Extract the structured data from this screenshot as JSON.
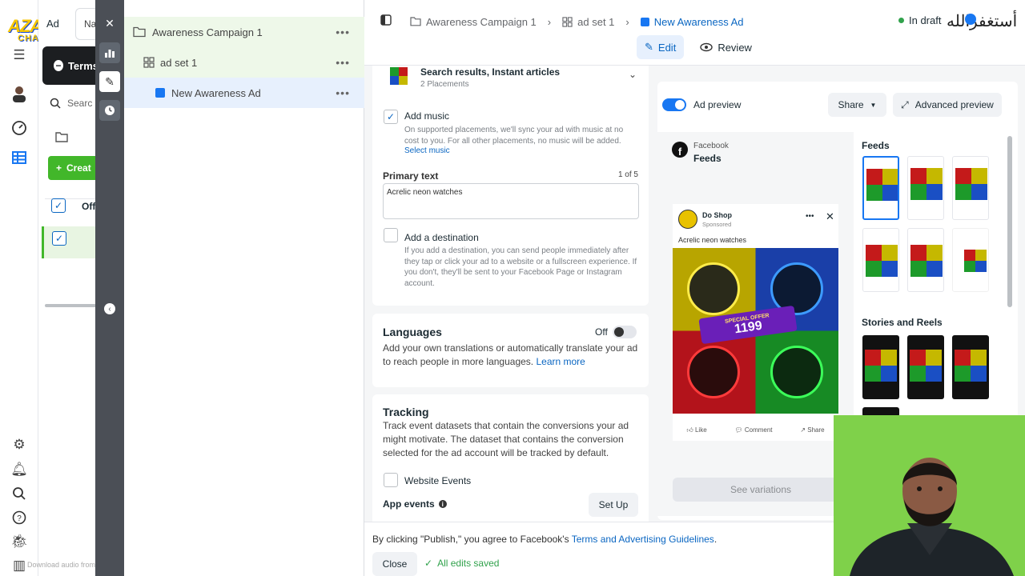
{
  "brand": {
    "logo_top": "AZAD",
    "logo_bottom": "CHAIWALA",
    "corner_script": "أستغفرالله"
  },
  "background": {
    "tab_partial": "Ad",
    "tab_partial_2": "Na",
    "terms_label": "Terms",
    "search_placeholder": "Searc",
    "create_label": "Creat",
    "column_partial": "Off",
    "download_hint": "Download audio from this page"
  },
  "tree": {
    "campaign": "Awareness Campaign 1",
    "adset": "ad set 1",
    "ad": "New Awareness Ad",
    "more_glyph": "•••"
  },
  "topbar": {
    "crumb_campaign": "Awareness Campaign 1",
    "crumb_adset": "ad set 1",
    "crumb_ad": "New Awareness Ad",
    "status": "In draft",
    "tab_edit": "Edit",
    "tab_review": "Review"
  },
  "editor": {
    "placements_title": "Search results, Instant articles",
    "placements_sub": "2 Placements",
    "music_label": "Add music",
    "music_help": "On supported placements, we'll sync your ad with music at no cost to you. For all other placements, no music will be added.",
    "music_link": "Select music",
    "primary_text_label": "Primary text",
    "primary_text_count": "1 of 5",
    "primary_text_value": "Acrelic neon watches",
    "destination_label": "Add a destination",
    "destination_help": "If you add a destination, you can send people immediately after they tap or click your ad to a website or a fullscreen experience. If you don't, they'll be sent to your Facebook Page or Instagram account.",
    "languages_title": "Languages",
    "languages_state": "Off",
    "languages_help": "Add your own translations or automatically translate your ad to reach people in more languages.",
    "languages_link": "Learn more",
    "tracking_title": "Tracking",
    "tracking_help": "Track event datasets that contain the conversions your ad might motivate. The dataset that contains the conversion selected for the ad account will be tracked by default.",
    "website_events": "Website Events",
    "app_events": "App events",
    "setup_btn": "Set Up"
  },
  "preview": {
    "toggle_label": "Ad preview",
    "share_btn": "Share",
    "advanced_btn": "Advanced preview",
    "platform": "Facebook",
    "placement": "Feeds",
    "post_page": "Do Shop",
    "post_sponsored": "Sponsored",
    "post_text": "Acrelic neon watches",
    "offer_text": "SPECIAL OFFER",
    "price_text": "1199",
    "like": "Like",
    "comment": "Comment",
    "share": "Share",
    "variations_btn": "See variations",
    "feeds_heading": "Feeds",
    "stories_heading": "Stories and Reels"
  },
  "footer": {
    "agree_prefix": "By clicking \"Publish,\" you agree to Facebook's ",
    "agree_link": "Terms and Advertising Guidelines",
    "agree_suffix": ".",
    "close_btn": "Close",
    "saved": "All edits saved"
  },
  "colors": {
    "accent": "#0a66c2",
    "toggle": "#1877f2",
    "success": "#31a24c",
    "draft": "#31a24c"
  }
}
